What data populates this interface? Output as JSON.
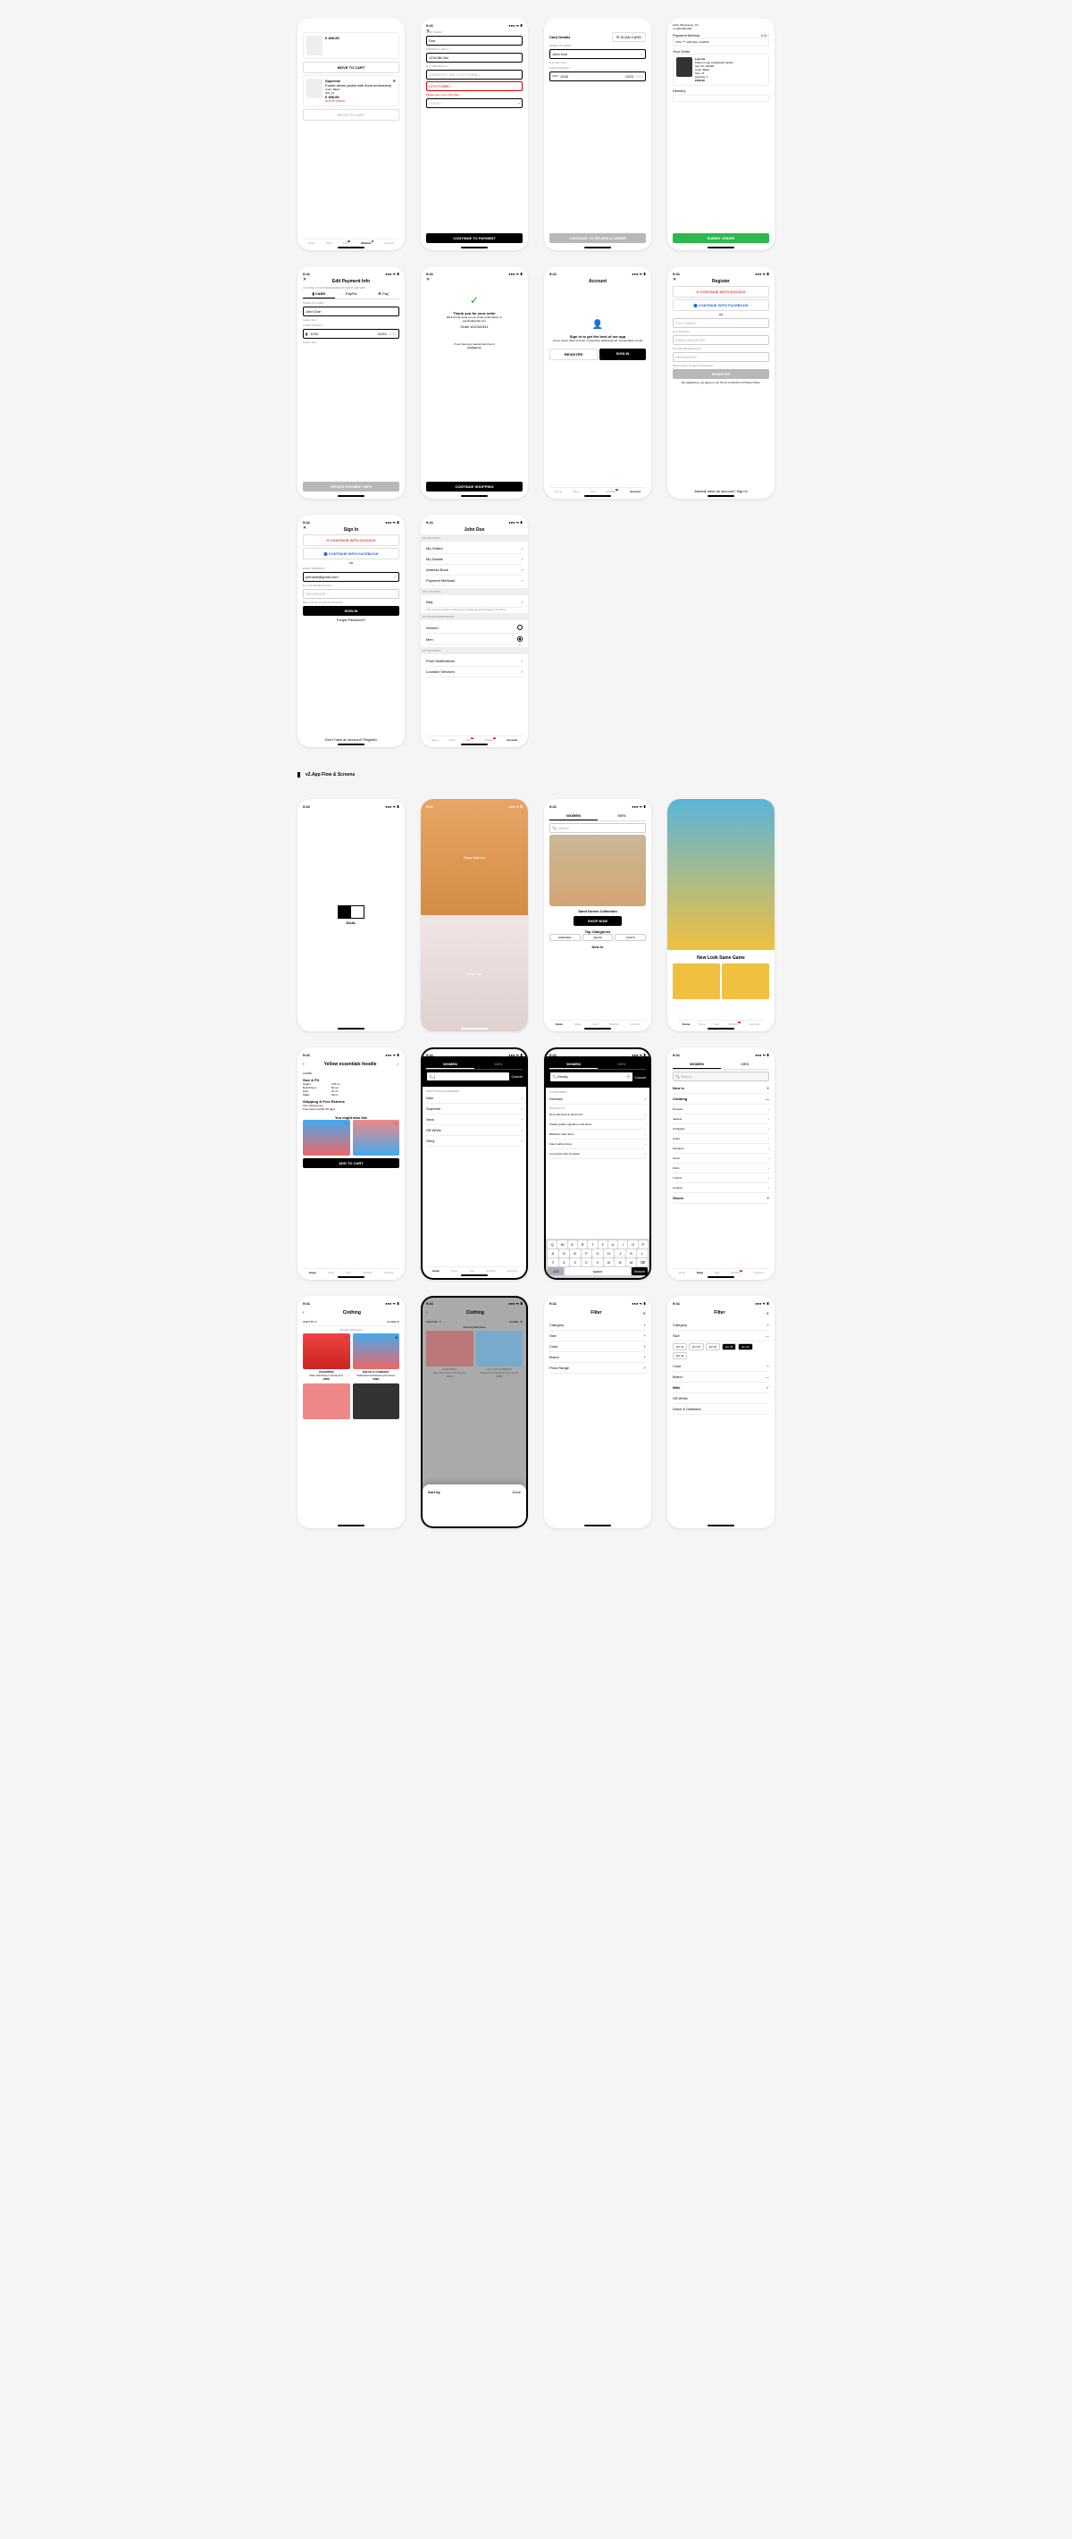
{
  "common": {
    "time": "9:41",
    "signal": "●●● ⏦ ▮",
    "home": "Home",
    "shop": "Shop",
    "cart": "Cart",
    "wishlist": "Wishlist",
    "account": "Account",
    "close": "✕",
    "back": "‹",
    "chev": "›",
    "plus": "+",
    "minus": "—",
    "heart": "♡"
  },
  "s1": {
    "brand": "Supreme",
    "pname": "Faded denim jacket with floral embroidery",
    "colorL": "Color:",
    "color": "Black",
    "sizeL": "Size:",
    "size": "M",
    "price": "€ 499,99",
    "old": "€ 499,99",
    "oos": "OUT OF STOCK",
    "move": "MOVE TO CART",
    "dot": "•"
  },
  "s2": {
    "last": "LAST NAME *",
    "doe": "Doe",
    "a1": "ADDRESS LINE 1 *",
    "a1v": "1234 8th Avl",
    "a1h": "E.g. 1234 8th Ave",
    "a2": "ADDRESS LINE 2 (OPTIONAL)",
    "city": "CITY/TOWN *",
    "cityerr": "Please enter your City/Town",
    "state": "STATE *",
    "cont": "CONTINUE TO PAYMENT"
  },
  "s3": {
    "cd": "Card Details",
    "scan": "⊡ SCAN CARD",
    "noc": "NAME ON CARD *",
    "nocv": "John Doe",
    "nh": "E.g. John Doe",
    "cdl": "CARD DETAILS *",
    "cn": "1234",
    "exp": "12/21",
    "cvv": "CVV",
    "visa": "VISA",
    "cont": "CONTINUE TO REVIEW & ORDER"
  },
  "s4": {
    "addr": "1234, 8th Avenue, NY",
    "ph": "+1 000-000-000",
    "pm": "Payment Method",
    "edit": "Edit ›",
    "card": "*** 1234   Exp: 12/2029",
    "yo": "Your Order",
    "brand": "Lacoste",
    "pn": "Pattern Logo Lightweight Jacket",
    "id": "Item ID: 123456",
    "col": "Color: Black",
    "sz": "Size: M",
    "qty": "Quantity: 1",
    "pr": "€499,99",
    "del": "Delivery",
    "sub": "SUBMIT ORDER"
  },
  "s5": {
    "title": "Edit Payment Info",
    "sub": "CHOOSE YOUR PREFERRED PAYMENT METHOD",
    "t1": "▮ CARD",
    "t2": "PayPal",
    "t3": "⌘ Pay",
    "noc": "NAME ON CARD *",
    "v": "John Doe",
    "h": "Helper Text",
    "cd": "CARD DETAILS *",
    "n": "1234",
    "e": "01/24",
    "c": "CVV",
    "btn": "UPDATE PAYMENT INFO"
  },
  "s6": {
    "ty": "Thank you for your order",
    "msg": "We'll shortly send you an email confirmation to:",
    "em": "joedoe@gmail.com",
    "ord": "Order #12342341",
    "q": "If you have any queries feel free to",
    "cu": "Contact us",
    "btn": "CONTINUE SHOPPING"
  },
  "s7": {
    "title": "Account",
    "msg": "Sign in to get the best of our app",
    "lorem": "Lorem ipsum dolor sit amet, consectetur adipiscing elit. Suspendisse vel elit",
    "reg": "REGISTER",
    "si": "SIGN IN"
  },
  "s8": {
    "title": "Register",
    "g": "CONTINUE WITH GOOGLE",
    "f": "CONTINUE WITH FACEBOOK",
    "or": "OR",
    "fn": "FULL NAME*",
    "fnh": "E.g. John Doe",
    "em": "EMAIL ADDRESS*",
    "emh": "E.g. johndoe@dual.com",
    "pw": "PASSWORD *",
    "pwh": "Must contain at least 8 characters",
    "btn": "REGISTER",
    "terms": "By registering, you agree to our Terms of Service & Privacy Policy",
    "al": "Already have an account? Sign in"
  },
  "s9": {
    "title": "Sign In",
    "g": "CONTINUE WITH GOOGLE",
    "f": "CONTINUE WITH FACEBOOK",
    "or": "OR",
    "em": "EMAIL ADDRESS *",
    "emv": "johndoe@gmail.com",
    "emh": "E.g. johndoe@dual.com",
    "pw": "PASSWORD *",
    "pwh": "Must contain at least 8 characters",
    "btn": "SIGN IN",
    "fp": "Forgot Password?",
    "no": "Don't have an account? Register"
  },
  "s10": {
    "title": "John Doe",
    "s1": "MY ACCOUNT",
    "i1": "My Orders",
    "i2": "My Details",
    "i3": "Address Book",
    "i4": "Payment Methods",
    "s2": "MY LOCATION",
    "loc": "Italy",
    "locd": "Your chosen location defines your language and shopping currency",
    "s3": "MY SHOP PREFERENCE",
    "w": "Women",
    "m": "Men",
    "s4": "MY SETTINGS",
    "pn": "Push Notifications",
    "ls": "Location Services"
  },
  "hdr": {
    "v2": "v2.App Flow & Screens"
  },
  "s11": {
    "dual": "DUAL"
  },
  "s12": {
    "sw": "Shop Women",
    "sm": "Shop Men"
  },
  "s13": {
    "w": "WOMEN",
    "m": "MEN",
    "search": "Search",
    "coll": "Sand Dunes Collection",
    "sn": "SHOP NOW",
    "tc": "Top Categories",
    "d": "DRESSES",
    "j": "JEANS",
    "c": "COATS",
    "ni": "New In"
  },
  "s14": {
    "t": "New Look Same Game"
  },
  "s15": {
    "title": "Yellow essentials hoodie",
    "id": "123456",
    "sf": "Size & Fit",
    "h": "Height",
    "hv": "178 cm",
    "b": "Bust/Chest",
    "bv": "82 cm",
    "hp": "Hips",
    "hpv": "91 cm",
    "w": "Waist",
    "wv": "61cm",
    "sh": "Shipping & Free Returns",
    "sh1": "One shipping fee",
    "sh2": "Free returns within 30 days",
    "yml": "You might also like",
    "atc": "ADD TO CART"
  },
  "s16": {
    "w": "WOMEN",
    "m": "MEN",
    "cancel": "Cancel",
    "mp": "MOST POPULAR BRANDS",
    "b1": "Nike",
    "b2": "Supreme",
    "b3": "Vans",
    "b4": "Off-White",
    "b5": "Obey"
  },
  "s17": {
    "w": "WOMEN",
    "m": "MEN",
    "q": "Dress|",
    "cancel": "Cancel",
    "cat": "CATEGORIES",
    "c1": "Dresses",
    "pr": "PRODUCTS",
    "p1": "Red midi dress in floral print",
    "p2": "Classic golden signature midi dress",
    "p3": "Backless maxi dress",
    "p4": "Faux leather dress",
    "p5": "Luxe dress with zip detail"
  },
  "s18": {
    "w": "WOMEN",
    "m": "MEN",
    "search": "Search",
    "ni": "New in",
    "cl": "Clothing",
    "i1": "Dresses",
    "i2": "Jackets",
    "i3": "Cardigans",
    "i4": "Coats",
    "i5": "Sweaters",
    "i6": "Jeans",
    "i7": "Shirts",
    "i8": "T-Shirts",
    "i9": "Lingerie",
    "sh": "Shoes"
  },
  "s19": {
    "title": "Clothing",
    "sb": "SORT BY",
    "f": "FILTER",
    "show": "Showing 680 items",
    "b1": "VALENTINO",
    "p1": "Red midi dress in floral print",
    "pr1": "€699",
    "b2": "DOLCE & GABBANA",
    "p2": "Multicolored abstract print dress",
    "pr2": "€899"
  },
  "s20": {
    "title": "Clothing",
    "sb": "SORT BY",
    "f": "FILTER",
    "show": "Showing 680 items",
    "sbt": "Sort by",
    "done": "Done"
  },
  "s21": {
    "title": "Filter",
    "c": "Category",
    "s": "Size",
    "co": "Color",
    "b": "Brand",
    "pr": "Price Range"
  },
  "s22": {
    "title": "Filter",
    "c": "Category",
    "s": "Size",
    "s1": "EU 32",
    "s2": "EU 34",
    "s3": "EU 36",
    "s4": "EU 38",
    "s5": "EU 40",
    "s6": "EU 42",
    "co": "Color",
    "b": "Brand",
    "b1": "Nike",
    "b2": "Off-White",
    "b3": "Dolce & Gabbana"
  },
  "kb": {
    "r1": [
      "Q",
      "W",
      "E",
      "R",
      "T",
      "Y",
      "U",
      "I",
      "O",
      "P"
    ],
    "r2": [
      "A",
      "S",
      "D",
      "F",
      "G",
      "H",
      "J",
      "K",
      "L"
    ],
    "r3": [
      "⇧",
      "Z",
      "X",
      "C",
      "V",
      "B",
      "N",
      "M",
      "⌫"
    ],
    "n": "123",
    "sp": "space",
    "se": "Search"
  }
}
